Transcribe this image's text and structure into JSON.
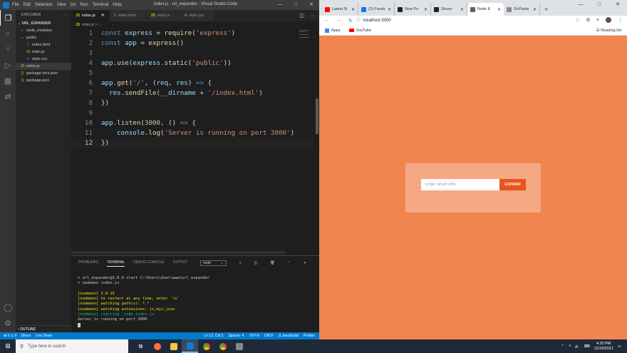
{
  "vscode": {
    "menu": [
      "File",
      "Edit",
      "Selection",
      "View",
      "Go",
      "Run",
      "Terminal",
      "Help"
    ],
    "window_title": "index.js - url_expander - Visual Studio Code",
    "explorer_label": "EXPLORER",
    "project": "URL_EXPANDER",
    "tree": [
      {
        "icon": "›",
        "label": "node_modules",
        "indent": 6
      },
      {
        "icon": "⌄",
        "label": "public",
        "indent": 6
      },
      {
        "icon": "5",
        "label": "index.html",
        "indent": 14,
        "color": "#e44d26"
      },
      {
        "icon": "JS",
        "label": "main.js",
        "indent": 14,
        "color": "#e8c400"
      },
      {
        "icon": "#",
        "label": "style.css",
        "indent": 14,
        "color": "#42a5f5"
      },
      {
        "icon": "JS",
        "label": "index.js",
        "indent": 6,
        "color": "#e8c400",
        "selected": true
      },
      {
        "icon": "{}",
        "label": "package-lock.json",
        "indent": 6,
        "color": "#cbcb41"
      },
      {
        "icon": "{}",
        "label": "package.json",
        "indent": 6,
        "color": "#cbcb41"
      }
    ],
    "outline_label": "OUTLINE",
    "tabs": [
      {
        "icon": "JS",
        "label": "index.js",
        "active": true,
        "color": "#e8c400"
      },
      {
        "icon": "5",
        "label": "index.html",
        "active": false,
        "color": "#e44d26"
      },
      {
        "icon": "JS",
        "label": "main.js",
        "active": false,
        "color": "#e8c400"
      },
      {
        "icon": "#",
        "label": "style.css",
        "active": false,
        "color": "#42a5f5"
      }
    ],
    "breadcrumb": "index.js > ...",
    "code_lines": [
      [
        [
          "kw",
          "const "
        ],
        [
          "var",
          "express"
        ],
        [
          "punc",
          " = "
        ],
        [
          "fn",
          "require"
        ],
        [
          "punc",
          "("
        ],
        [
          "str",
          "'express'"
        ],
        [
          "punc",
          ")"
        ]
      ],
      [
        [
          "kw",
          "const "
        ],
        [
          "var",
          "app"
        ],
        [
          "punc",
          " = "
        ],
        [
          "fn",
          "express"
        ],
        [
          "punc",
          "()"
        ]
      ],
      [],
      [
        [
          "var",
          "app"
        ],
        [
          "punc",
          "."
        ],
        [
          "fn",
          "use"
        ],
        [
          "punc",
          "("
        ],
        [
          "var",
          "express"
        ],
        [
          "punc",
          "."
        ],
        [
          "fn",
          "static"
        ],
        [
          "punc",
          "("
        ],
        [
          "str",
          "'public'"
        ],
        [
          "punc",
          "))"
        ]
      ],
      [],
      [
        [
          "var",
          "app"
        ],
        [
          "punc",
          "."
        ],
        [
          "fn",
          "get"
        ],
        [
          "punc",
          "("
        ],
        [
          "str",
          "'/'"
        ],
        [
          "punc",
          ", ("
        ],
        [
          "var",
          "req"
        ],
        [
          "punc",
          ", "
        ],
        [
          "var",
          "res"
        ],
        [
          "punc",
          ") "
        ],
        [
          "kw",
          "=>"
        ],
        [
          "punc",
          " {"
        ]
      ],
      [
        [
          "punc",
          "  "
        ],
        [
          "var",
          "res"
        ],
        [
          "punc",
          "."
        ],
        [
          "fn",
          "sendFile"
        ],
        [
          "punc",
          "("
        ],
        [
          "var",
          "__dirname"
        ],
        [
          "punc",
          " + "
        ],
        [
          "str",
          "'/index.html'"
        ],
        [
          "punc",
          ")"
        ]
      ],
      [
        [
          "punc",
          "})"
        ]
      ],
      [],
      [
        [
          "var",
          "app"
        ],
        [
          "punc",
          "."
        ],
        [
          "fn",
          "listen"
        ],
        [
          "punc",
          "("
        ],
        [
          "num",
          "3000"
        ],
        [
          "punc",
          ", () "
        ],
        [
          "kw",
          "=>"
        ],
        [
          "punc",
          " {"
        ]
      ],
      [
        [
          "punc",
          "    "
        ],
        [
          "var",
          "console"
        ],
        [
          "punc",
          "."
        ],
        [
          "fn",
          "log"
        ],
        [
          "punc",
          "("
        ],
        [
          "str",
          "'Server is running on port 3000'"
        ],
        [
          "punc",
          ")"
        ]
      ],
      [
        [
          "punc",
          "})"
        ]
      ]
    ],
    "panel_tabs": [
      "PROBLEMS",
      "TERMINAL",
      "DEBUG CONSOLE",
      "OUTPUT"
    ],
    "terminal_select": "node",
    "terminal": [
      {
        "c": "",
        "t": "> url_expander@1.0.0 start C:\\Users\\User\\www\\url_expander"
      },
      {
        "c": "",
        "t": "> nodemon index.js"
      },
      {
        "c": "",
        "t": ""
      },
      {
        "c": "y",
        "t": "[nodemon] 2.0.15"
      },
      {
        "c": "y",
        "t": "[nodemon] to restart at any time, enter `rs`"
      },
      {
        "c": "y",
        "t": "[nodemon] watching path(s): *.*"
      },
      {
        "c": "y",
        "t": "[nodemon] watching extensions: js,mjs,json"
      },
      {
        "c": "g",
        "t": "[nodemon] starting `node index.js`"
      },
      {
        "c": "",
        "t": "Server is running on port 3000"
      }
    ],
    "status_left": [
      "⊗ 0 ⚠ 0",
      "Shuvo",
      "Live Share"
    ],
    "status_right": [
      "Ln 12, Col 3",
      "Spaces: 4",
      "UTF-8",
      "CRLF",
      "{} JavaScript",
      "Prettier"
    ]
  },
  "chrome": {
    "tabs": [
      {
        "label": "Latest Si",
        "color": "#ff0000"
      },
      {
        "label": "(2) Faceb",
        "color": "#1877f2"
      },
      {
        "label": "New Po",
        "color": "#222"
      },
      {
        "label": "Shuvo",
        "color": "#222"
      },
      {
        "label": "Node E",
        "color": "#5f6368",
        "active": true
      },
      {
        "label": "OnPaste",
        "color": "#888"
      }
    ],
    "url": "localhost:3000",
    "bookmarks": [
      "Apps",
      "YouTube"
    ],
    "reading_list": "Reading list",
    "page": {
      "input_placeholder": "Enter Short URL",
      "button_label": "EXPAND"
    }
  },
  "taskbar": {
    "search_placeholder": "Type here to search",
    "time": "4:20 PM",
    "date": "11/19/2021"
  }
}
